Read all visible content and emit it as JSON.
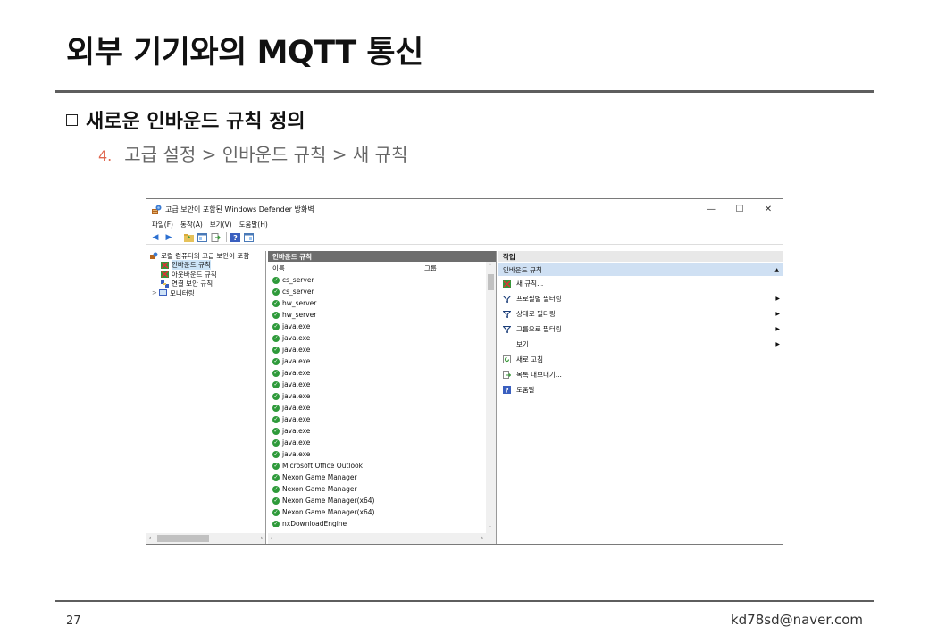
{
  "slide": {
    "title": "외부 기기와의 MQTT 통신",
    "heading": "새로운 인바운드 규칙 정의",
    "step_number": "4.",
    "step_text": "고급 설정 > 인바운드 규칙 > 새 규칙",
    "page_number": "27",
    "email": "kd78sd@naver.com"
  },
  "window": {
    "title": "고급 보안이 포함된 Windows Defender 방화벽",
    "minimize": "—",
    "maximize": "☐",
    "close": "✕",
    "menu": [
      "파일(F)",
      "동작(A)",
      "보기(V)",
      "도움말(H)"
    ]
  },
  "tree": {
    "root": "로컬 컴퓨터의 고급 보안이 포함",
    "items": [
      "인바운드 규칙",
      "아웃바운드 규칙",
      "연결 보안 규칙",
      "모니터링"
    ],
    "expander": ">"
  },
  "middle": {
    "header": "인바운드 규칙",
    "col_name": "이름",
    "col_group": "그룹",
    "rows": [
      "cs_server",
      "cs_server",
      "hw_server",
      "hw_server",
      "java.exe",
      "java.exe",
      "java.exe",
      "java.exe",
      "java.exe",
      "java.exe",
      "java.exe",
      "java.exe",
      "java.exe",
      "java.exe",
      "java.exe",
      "java.exe",
      "Microsoft Office Outlook",
      "Nexon Game Manager",
      "Nexon Game Manager",
      "Nexon Game Manager(x64)",
      "Nexon Game Manager(x64)",
      "nxDownloadEngine"
    ]
  },
  "actions": {
    "header": "작업",
    "section": "인바운드 규칙",
    "items": [
      "새 규칙...",
      "프로필별 필터링",
      "상태로 필터링",
      "그룹으로 필터링",
      "보기",
      "새로 고침",
      "목록 내보내기...",
      "도움말"
    ]
  },
  "colors": {
    "accent": "#e0674f",
    "header_gray": "#6d6d6d",
    "check_green": "#2e9a3a",
    "selection": "#cfe0f3"
  }
}
